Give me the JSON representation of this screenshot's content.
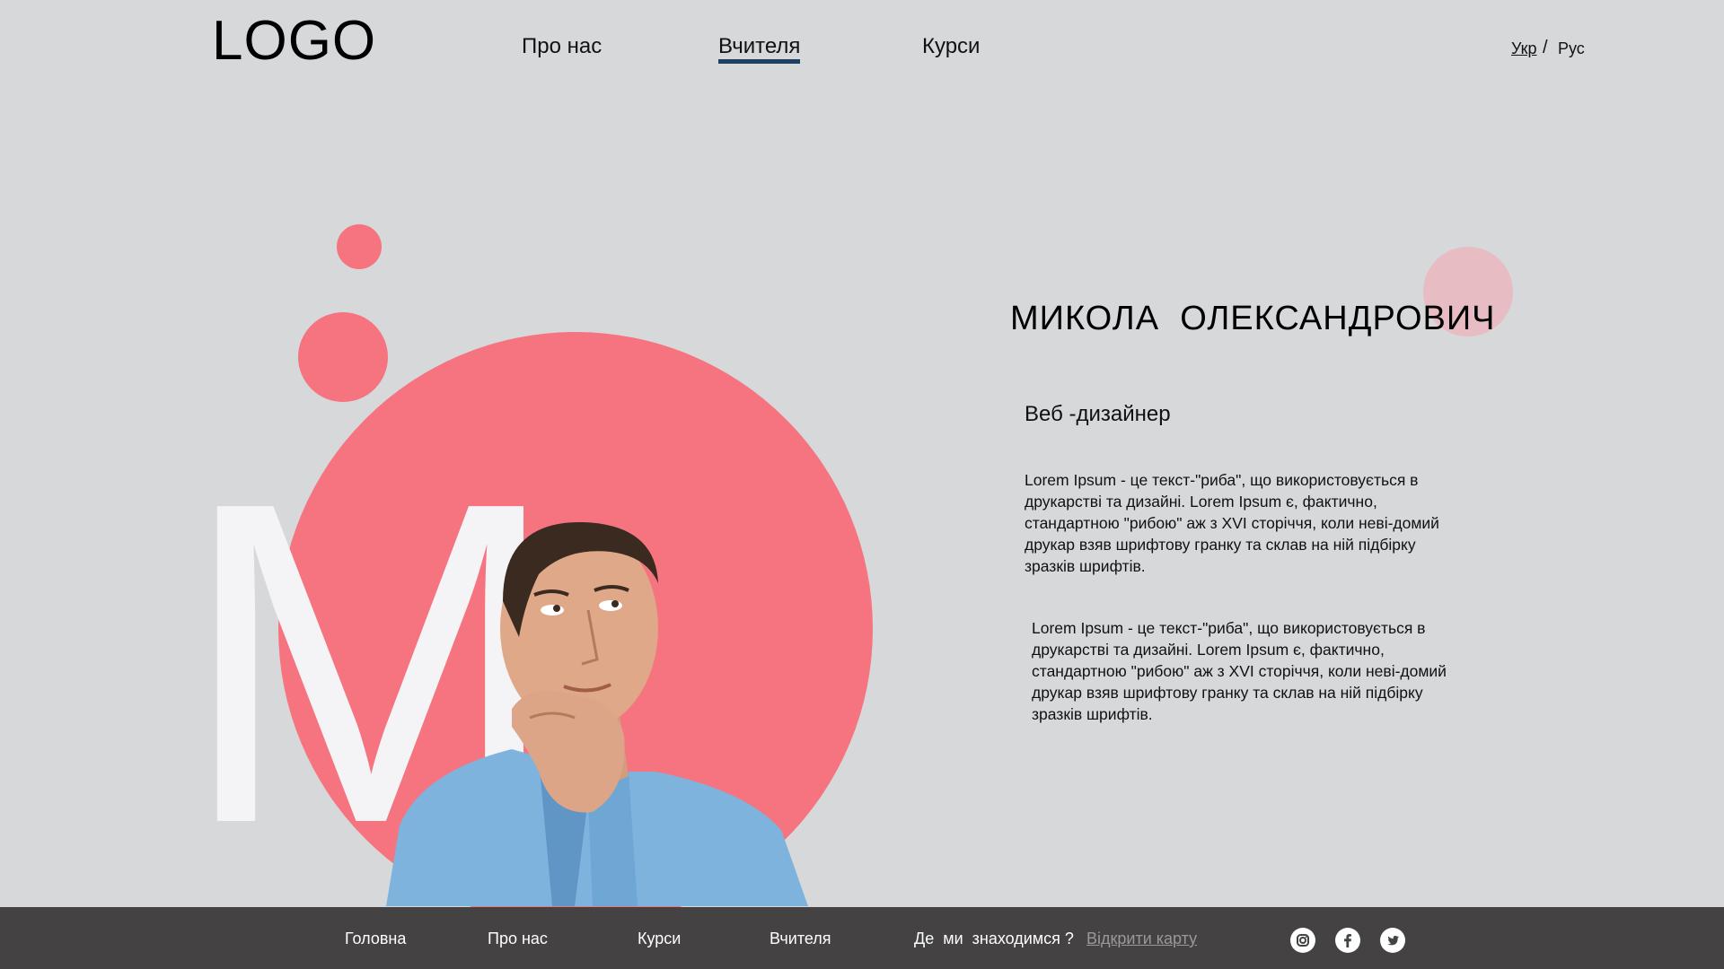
{
  "header": {
    "logo": "LOGO",
    "nav": [
      {
        "label": "Про нас"
      },
      {
        "label": "Вчителя"
      },
      {
        "label": "Курси"
      }
    ],
    "lang": {
      "ua": "Укр",
      "separator": "/",
      "ru": "Рус"
    }
  },
  "hero": {
    "monogram": "M"
  },
  "teacher": {
    "name": "МИКОЛА  ОЛЕКСАНДРОВИЧ",
    "role": "Веб -дизайнер",
    "bio": [
      "Lorem Ipsum - це текст-\"риба\", що використовується в друкарстві та дизайні. Lorem Ipsum є, фактично, стандартною  \"рибою\" аж з XVI сторіччя, коли неві-домий друкар взяв шрифтову гранку та склав на ній підбірку зразків шрифтів.",
      "Lorem Ipsum - це текст-\"риба\", що використовується в друкарстві та дизайні. Lorem Ipsum є, фактично, стандартною  \"рибою\" аж з XVI сторіччя, коли неві-домий друкар взяв шрифтову гранку та склав на ній підбірку зразків шрифтів."
    ]
  },
  "footer": {
    "links": [
      {
        "label": "Головна"
      },
      {
        "label": "Про нас"
      },
      {
        "label": "Курси"
      },
      {
        "label": "Вчителя"
      }
    ],
    "location_label": "Де  ми  знаходимся ?",
    "map_link": "Відкрити карту",
    "social": [
      {
        "icon": "instagram-icon"
      },
      {
        "icon": "facebook-icon"
      },
      {
        "icon": "twitter-icon"
      }
    ]
  },
  "colors": {
    "background": "#d7d8da",
    "accent_pink": "#f6747f",
    "light_pink": "#e7bcc3",
    "nav_underline": "#1d3f63",
    "footer": "#444242"
  }
}
